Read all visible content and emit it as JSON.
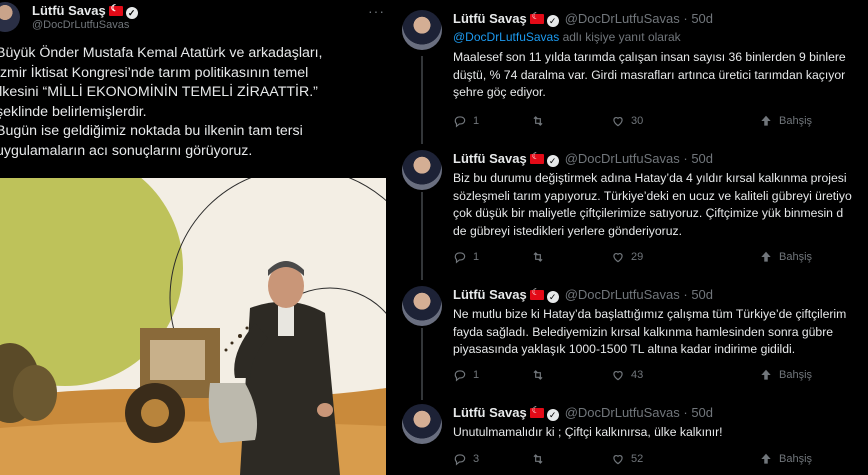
{
  "left_tweet": {
    "name": "Lütfü Savaş",
    "handle": "@DocDrLutfuSavas",
    "more": "···",
    "lines": [
      "Büyük Önder Mustafa Kemal Atatürk ve arkadaşları,",
      "İzmir İktisat Kongresi’nde tarım politikasının temel",
      "ilkesini “MİLLİ EKONOMİNİN TEMELİ ZİRAATTİR.”",
      "şeklinde belirlemişlerdir.",
      "Bugün ise geldiğimiz noktada bu ilkenin tam tersi",
      "uygulamaların acı sonuçlarını görüyoruz."
    ]
  },
  "thread": [
    {
      "name": "Lütfü Savaş",
      "handle": "@DocDrLutfuSavas · 50d",
      "reply_to_handle": "@DocDrLutfuSavas",
      "reply_suffix": " adlı kişiye yanıt olarak",
      "lines": [
        "Maalesef son 11 yılda tarımda çalışan insan sayısı 36 binlerden 9 binlere",
        "düştü, % 74 daralma var. Girdi masrafları artınca üretici tarımdan kaçıyor",
        "şehre göç ediyor."
      ],
      "replies": "1",
      "retweets": "",
      "likes": "30",
      "tip": "Bahşiş"
    },
    {
      "name": "Lütfü Savaş",
      "handle": "@DocDrLutfuSavas · 50d",
      "lines": [
        "Biz bu durumu değiştirmek adına Hatay’da 4 yıldır kırsal kalkınma projesi",
        "sözleşmeli tarım yapıyoruz. Türkiye’deki en ucuz ve kaliteli gübreyi üretiyo",
        "çok düşük bir maliyetle çiftçilerimize satıyoruz. Çiftçimize yük binmesin d",
        "de gübreyi istedikleri yerlere gönderiyoruz."
      ],
      "replies": "1",
      "retweets": "",
      "likes": "29",
      "tip": "Bahşiş"
    },
    {
      "name": "Lütfü Savaş",
      "handle": "@DocDrLutfuSavas · 50d",
      "lines": [
        "Ne mutlu bize ki Hatay’da başlattığımız çalışma tüm Türkiye’de çiftçilerim",
        "fayda sağladı. Belediyemizin kırsal kalkınma hamlesinden sonra gübre",
        "piyasasında yaklaşık 1000-1500 TL altına kadar indirime gidildi."
      ],
      "replies": "1",
      "retweets": "",
      "likes": "43",
      "tip": "Bahşiş"
    },
    {
      "name": "Lütfü Savaş",
      "handle": "@DocDrLutfuSavas · 50d",
      "lines": [
        "Unutulmamalıdır ki ; Çiftçi kalkınırsa, ülke kalkınır!"
      ],
      "replies": "3",
      "retweets": "",
      "likes": "52",
      "tip": "Bahşiş"
    }
  ],
  "colors": {
    "background": "#000000",
    "text": "#e7e9ea",
    "muted": "#71767b",
    "link": "#1d9bf0",
    "flag_red": "#e30a17"
  },
  "icons": [
    "reply-icon",
    "retweet-icon",
    "like-icon",
    "tip-icon",
    "verified-icon",
    "turkish-flag-icon",
    "more-icon"
  ]
}
